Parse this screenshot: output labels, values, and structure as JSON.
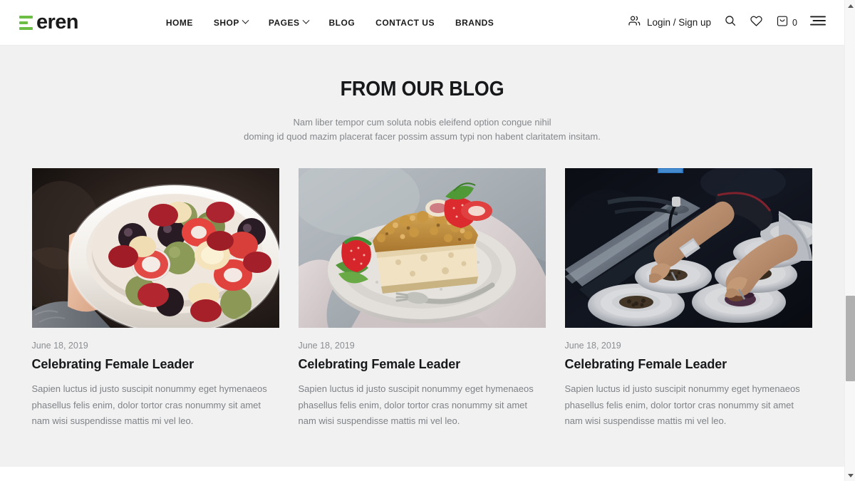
{
  "header": {
    "logo": {
      "text": "eren",
      "bars_icon": "three-bars-icon",
      "accent_color": "#6dbe45"
    },
    "nav": [
      {
        "label": "HOME",
        "has_dropdown": false
      },
      {
        "label": "SHOP",
        "has_dropdown": true
      },
      {
        "label": "PAGES",
        "has_dropdown": true
      },
      {
        "label": "BLOG",
        "has_dropdown": false
      },
      {
        "label": "CONTACT US",
        "has_dropdown": false
      },
      {
        "label": "BRANDS",
        "has_dropdown": false
      }
    ],
    "account": {
      "icon": "users-icon",
      "label": "Login / Sign up"
    },
    "search": {
      "icon": "search-icon"
    },
    "wishlist": {
      "icon": "heart-icon"
    },
    "cart": {
      "icon": "shopping-bag-icon",
      "count": "0"
    },
    "menu": {
      "icon": "hamburger-menu-icon"
    }
  },
  "main": {
    "title": "FROM OUR BLOG",
    "subtitle_line1": "Nam liber tempor cum soluta nobis eleifend option congue nihil",
    "subtitle_line2": "doming id quod mazim placerat facer possim assum typi non habent claritatem insitam.",
    "posts": [
      {
        "image_alt": "hand-holding-bowl-of-fruit-salad",
        "date": "June 18, 2019",
        "title": "Celebrating Female Leader",
        "excerpt": "Sapien luctus id justo suscipit nonummy eget hymenaeos phasellus felis enim, dolor tortor cras nonummy sit amet nam wisi suspendisse mattis mi vel leo."
      },
      {
        "image_alt": "crumble-cake-slice-with-strawberries-on-plate",
        "date": "June 18, 2019",
        "title": "Celebrating Female Leader",
        "excerpt": "Sapien luctus id justo suscipit nonummy eget hymenaeos phasellus felis enim, dolor tortor cras nonummy sit amet nam wisi suspendisse mattis mi vel leo."
      },
      {
        "image_alt": "chefs-plating-food-in-dark-kitchen",
        "date": "June 18, 2019",
        "title": "Celebrating Female Leader",
        "excerpt": "Sapien luctus id justo suscipit nonummy eget hymenaeos phasellus felis enim, dolor tortor cras nonummy sit amet nam wisi suspendisse mattis mi vel leo."
      }
    ]
  },
  "scrollbar": {
    "up_arrow": "scroll-up-arrow",
    "down_arrow": "scroll-down-arrow"
  }
}
